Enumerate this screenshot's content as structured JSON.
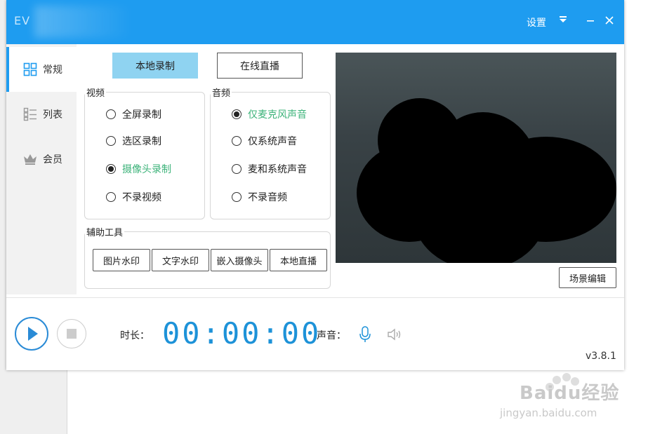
{
  "window": {
    "app_logo": "EV"
  },
  "titlebar": {
    "settings_label": "设置",
    "menu_icon": "dropdown-menu-icon",
    "minimize_icon": "minimize-icon",
    "close_icon": "close-icon"
  },
  "sidebar": {
    "items": [
      {
        "label": "常规",
        "icon": "grid-icon",
        "active": true
      },
      {
        "label": "列表",
        "icon": "list-icon",
        "active": false
      },
      {
        "label": "会员",
        "icon": "crown-icon",
        "active": false
      }
    ]
  },
  "mode_tabs": {
    "local_record": "本地录制",
    "live_stream": "在线直播"
  },
  "video_group": {
    "title": "视频",
    "options": [
      {
        "label": "全屏录制",
        "checked": false
      },
      {
        "label": "选区录制",
        "checked": false
      },
      {
        "label": "摄像头录制",
        "checked": true
      },
      {
        "label": "不录视频",
        "checked": false
      }
    ]
  },
  "audio_group": {
    "title": "音频",
    "options": [
      {
        "label": "仅麦克风声音",
        "checked": true
      },
      {
        "label": "仅系统声音",
        "checked": false
      },
      {
        "label": "麦和系统声音",
        "checked": false
      },
      {
        "label": "不录音频",
        "checked": false
      }
    ]
  },
  "tools_group": {
    "title": "辅助工具",
    "buttons": [
      "图片水印",
      "文字水印",
      "嵌入摄像头",
      "本地直播"
    ]
  },
  "scene_edit_label": "场景编辑",
  "bottom_bar": {
    "duration_label": "时长：",
    "timer": "00:00:00",
    "sound_label": "声音：",
    "version": "v3.8.1"
  },
  "colors": {
    "titlebar": "#1e9cf0",
    "accent_green": "#3db37a",
    "timer_blue": "#1d92d8",
    "primary_button": "#8fd3f1"
  },
  "watermark": {
    "brand": "Baidu经验",
    "site": "jingyan.baidu.com"
  }
}
